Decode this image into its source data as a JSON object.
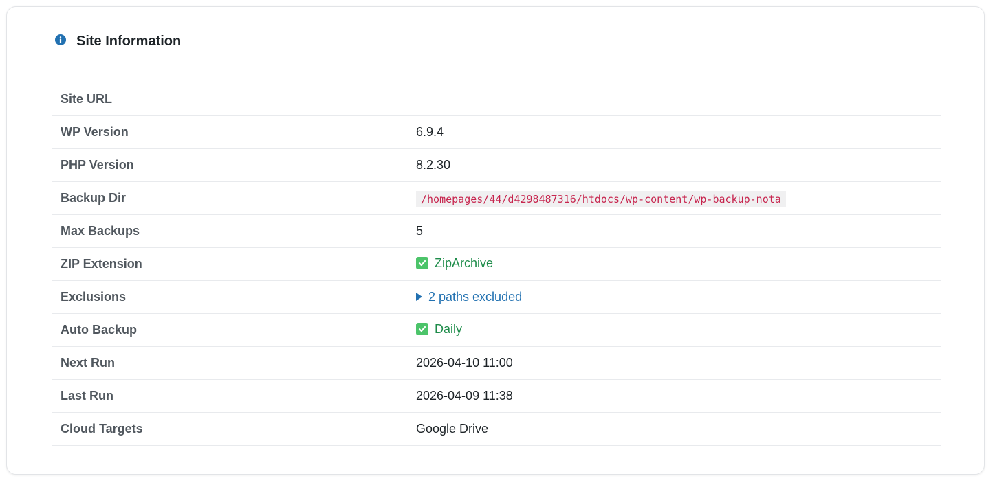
{
  "header": {
    "title": "Site Information",
    "icon": "info-icon",
    "icon_color": "#2271b1"
  },
  "rows": [
    {
      "label": "Site URL",
      "value": ""
    },
    {
      "label": "WP Version",
      "value": "6.9.4"
    },
    {
      "label": "PHP Version",
      "value": "8.2.30"
    },
    {
      "label": "Backup Dir",
      "value": "/homepages/44/d4298487316/htdocs/wp-content/wp-backup-nota"
    },
    {
      "label": "Max Backups",
      "value": "5"
    },
    {
      "label": "ZIP Extension",
      "value": "ZipArchive",
      "icon": "check-icon"
    },
    {
      "label": "Exclusions",
      "value": "2 paths excluded",
      "icon": "triangle-right-icon"
    },
    {
      "label": "Auto Backup",
      "value": "Daily",
      "icon": "check-icon"
    },
    {
      "label": "Next Run",
      "value": "2026-04-10 11:00"
    },
    {
      "label": "Last Run",
      "value": "2026-04-09 11:38"
    },
    {
      "label": "Cloud Targets",
      "value": "Google Drive"
    }
  ],
  "colors": {
    "success": "#1e8c4a",
    "link": "#2271b1",
    "code": "#c7254e"
  }
}
